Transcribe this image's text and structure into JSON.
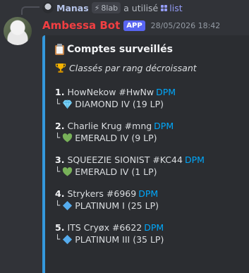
{
  "reply": {
    "user": "Manas",
    "command_chip": "8lab",
    "action": "a utilisé",
    "command": "list"
  },
  "message": {
    "author": "Ambessa Bot",
    "badge": "APP",
    "timestamp": "28/05/2026 18:42"
  },
  "embed": {
    "accent": "#3498db",
    "title_icon": "clipboard-icon",
    "title": "Comptes surveillés",
    "subtitle_icon": "trophy-icon",
    "subtitle": "Classés par rang décroissant",
    "entries": [
      {
        "rank": "1.",
        "player": "HowNekow #HwNw",
        "link": "DPM",
        "tree": "└",
        "tier_icon": "diamond-icon",
        "tier": "DIAMOND IV (19 LP)"
      },
      {
        "rank": "2.",
        "player": "Charlie Krug #mng",
        "link": "DPM",
        "tree": "└",
        "tier_icon": "green-heart-icon",
        "tier": "EMERALD IV (9 LP)"
      },
      {
        "rank": "3.",
        "player": "SQUEEZIE SIONIST #KC44",
        "link": "DPM",
        "tree": "└",
        "tier_icon": "green-heart-icon",
        "tier": "EMERALD IV (1 LP)"
      },
      {
        "rank": "4.",
        "player": "Strykers #6969",
        "link": "DPM",
        "tree": "└",
        "tier_icon": "blue-diamond-icon",
        "tier": "PLATINUM I (25 LP)"
      },
      {
        "rank": "5.",
        "player": "ITS Cryøx #6622",
        "link": "DPM",
        "tree": "└",
        "tier_icon": "blue-diamond-icon",
        "tier": "PLATINUM III (35 LP)"
      }
    ]
  }
}
